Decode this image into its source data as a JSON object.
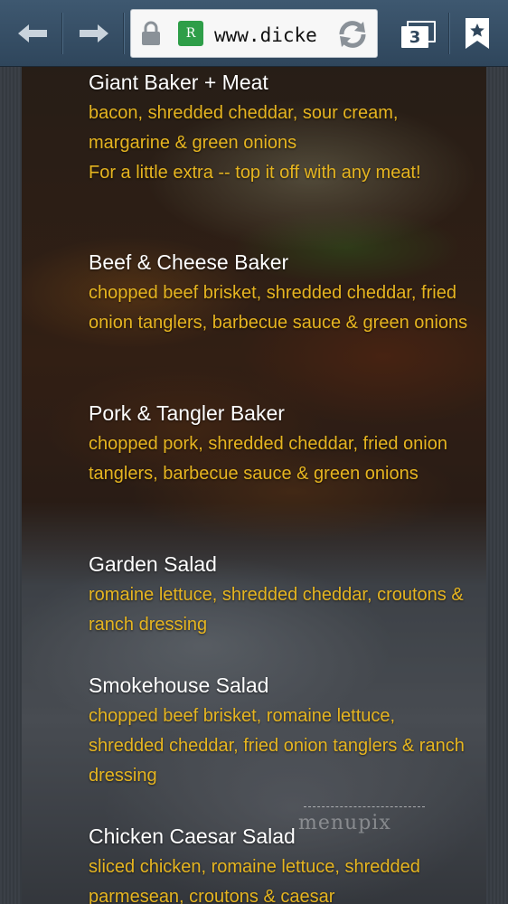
{
  "browser": {
    "url": "www.dicke",
    "site_icon": "R",
    "tab_count": "3",
    "icons": [
      "back-arrow-icon",
      "forward-arrow-icon",
      "lock-icon",
      "site-favicon",
      "reload-icon",
      "tabs-icon",
      "bookmark-star-icon"
    ]
  },
  "menu": {
    "items": [
      {
        "name": "Giant Baker + Meat",
        "desc": "bacon, shredded cheddar, sour cream, margarine & green onions\nFor a little extra -- top it off with any meat!"
      },
      {
        "name": "Beef & Cheese Baker",
        "desc": "chopped beef brisket, shredded cheddar, fried onion tanglers, barbecue sauce & green onions"
      },
      {
        "name": "Pork & Tangler Baker",
        "desc": "chopped pork, shredded cheddar, fried onion tanglers, barbecue sauce & green onions"
      },
      {
        "name": "Garden Salad",
        "desc": "romaine lettuce, shredded cheddar, croutons & ranch dressing"
      },
      {
        "name": "Smokehouse Salad",
        "desc": "chopped beef brisket, romaine lettuce, shredded cheddar, fried onion tanglers & ranch dressing"
      },
      {
        "name": "Chicken Caesar Salad",
        "desc": "sliced chicken, romaine lettuce, shredded parmesean, croutons & caesar"
      }
    ]
  },
  "watermark": {
    "text": "menupix"
  },
  "colors": {
    "toolbar": "#35506a",
    "item_name": "#ffffff",
    "item_desc": "#e6b520"
  }
}
